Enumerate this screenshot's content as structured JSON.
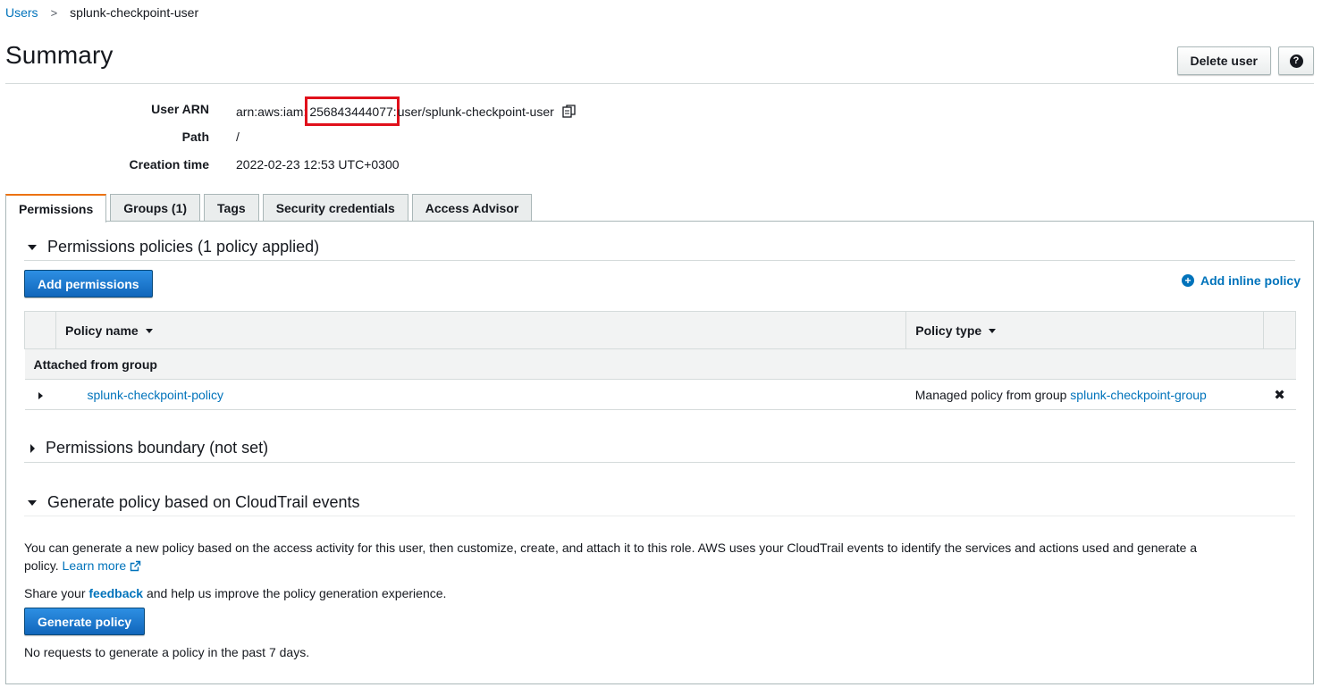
{
  "breadcrumb": {
    "parent": "Users",
    "separator": ">",
    "current": "splunk-checkpoint-user"
  },
  "header": {
    "title": "Summary",
    "delete_label": "Delete user",
    "help_label": "?"
  },
  "summary": {
    "arn_label": "User ARN",
    "arn_prefix": "arn:aws:iam:",
    "arn_account": "256843444077:",
    "arn_suffix": "user/splunk-checkpoint-user",
    "path_label": "Path",
    "path_value": "/",
    "creation_label": "Creation time",
    "creation_value": "2022-02-23 12:53 UTC+0300"
  },
  "tabs": [
    {
      "label": "Permissions",
      "active": true
    },
    {
      "label": "Groups (1)",
      "active": false
    },
    {
      "label": "Tags",
      "active": false
    },
    {
      "label": "Security credentials",
      "active": false
    },
    {
      "label": "Access Advisor",
      "active": false
    }
  ],
  "permissions": {
    "section_title": "Permissions policies (1 policy applied)",
    "add_permissions_label": "Add permissions",
    "add_inline_label": "Add inline policy",
    "add_inline_icon": "+",
    "columns": {
      "name": "Policy name",
      "type": "Policy type"
    },
    "group_label": "Attached from group",
    "rows": [
      {
        "name": "splunk-checkpoint-policy",
        "type_prefix": "Managed policy from group ",
        "type_link": "splunk-checkpoint-group",
        "remove_icon": "✖"
      }
    ]
  },
  "boundary": {
    "title": "Permissions boundary (not set)"
  },
  "generate": {
    "title": "Generate policy based on CloudTrail events",
    "description": "You can generate a new policy based on the access activity for this user, then customize, create, and attach it to this role. AWS uses your CloudTrail events to identify the services and actions used and generate a policy.",
    "learn_more": "Learn more",
    "share_prefix": "Share your ",
    "feedback": "feedback",
    "share_suffix": " and help us improve the policy generation experience.",
    "button_label": "Generate policy",
    "status": "No requests to generate a policy in the past 7 days."
  },
  "colors": {
    "link": "#0073bb",
    "primary": "#1166bb",
    "tab_accent": "#ec7211",
    "highlight": "#e0101b"
  }
}
